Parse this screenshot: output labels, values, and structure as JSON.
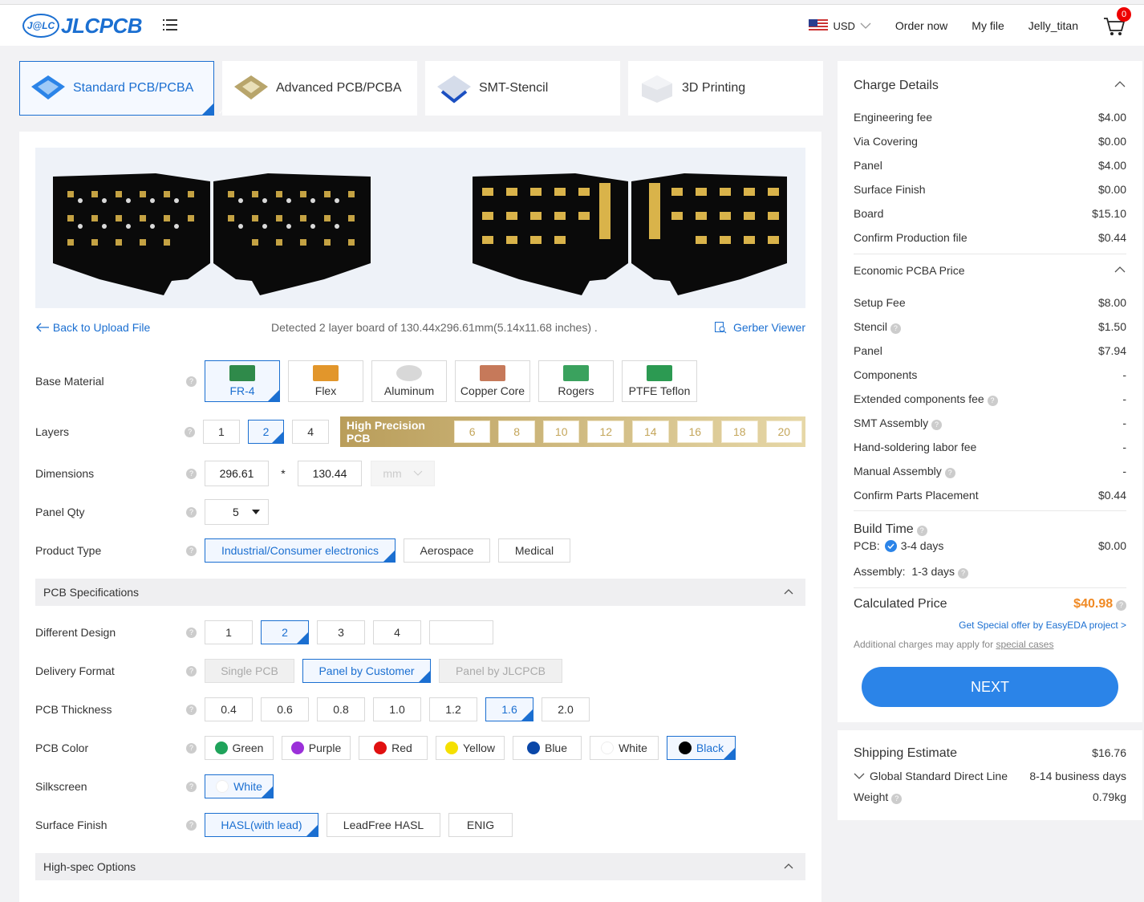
{
  "header": {
    "logo_badge": "J@LC",
    "logo_text": "JLCPCB",
    "currency": "USD",
    "order_now": "Order now",
    "my_file": "My file",
    "username": "Jelly_titan",
    "cart_count": "0"
  },
  "tabs": [
    {
      "label": "Standard PCB/PCBA",
      "active": true
    },
    {
      "label": "Advanced PCB/PCBA"
    },
    {
      "label": "SMT-Stencil"
    },
    {
      "label": "3D Printing"
    }
  ],
  "upload": {
    "back": "Back to Upload File",
    "detected": "Detected 2 layer board of 130.44x296.61mm(5.14x11.68 inches) .",
    "gerber": "Gerber Viewer"
  },
  "form": {
    "base_material": {
      "label": "Base Material",
      "options": [
        "FR-4",
        "Flex",
        "Aluminum",
        "Copper Core",
        "Rogers",
        "PTFE Teflon"
      ],
      "selected": "FR-4"
    },
    "layers": {
      "label": "Layers",
      "options": [
        "1",
        "2",
        "4"
      ],
      "selected": "2",
      "hp_label": "High Precision PCB",
      "hp_options": [
        "6",
        "8",
        "10",
        "12",
        "14",
        "16",
        "18",
        "20"
      ]
    },
    "dimensions": {
      "label": "Dimensions",
      "x": "296.61",
      "sep": "*",
      "y": "130.44",
      "unit": "mm"
    },
    "panel_qty": {
      "label": "Panel Qty",
      "value": "5"
    },
    "product_type": {
      "label": "Product Type",
      "options": [
        "Industrial/Consumer electronics",
        "Aerospace",
        "Medical"
      ],
      "selected": "Industrial/Consumer electronics"
    },
    "pcb_specs_title": "PCB Specifications",
    "different_design": {
      "label": "Different Design",
      "options": [
        "1",
        "2",
        "3",
        "4",
        ""
      ],
      "selected": "2"
    },
    "delivery_format": {
      "label": "Delivery Format",
      "options": [
        "Single PCB",
        "Panel by Customer",
        "Panel by JLCPCB"
      ],
      "selected": "Panel by Customer"
    },
    "thickness": {
      "label": "PCB Thickness",
      "options": [
        "0.4",
        "0.6",
        "0.8",
        "1.0",
        "1.2",
        "1.6",
        "2.0"
      ],
      "selected": "1.6"
    },
    "color": {
      "label": "PCB Color",
      "options": [
        {
          "name": "Green",
          "color": "#1fa35b"
        },
        {
          "name": "Purple",
          "color": "#9b30d9"
        },
        {
          "name": "Red",
          "color": "#e01010"
        },
        {
          "name": "Yellow",
          "color": "#f5e000"
        },
        {
          "name": "Blue",
          "color": "#0a47a8"
        },
        {
          "name": "White",
          "color": "#ffffff"
        },
        {
          "name": "Black",
          "color": "#000000"
        }
      ],
      "selected": "Black"
    },
    "silkscreen": {
      "label": "Silkscreen",
      "value": "White"
    },
    "surface_finish": {
      "label": "Surface Finish",
      "options": [
        "HASL(with lead)",
        "LeadFree HASL",
        "ENIG"
      ],
      "selected": "HASL(with lead)"
    },
    "highspec_title": "High-spec Options"
  },
  "charges": {
    "title": "Charge Details",
    "items": [
      {
        "label": "Engineering fee",
        "value": "$4.00"
      },
      {
        "label": "Via Covering",
        "value": "$0.00"
      },
      {
        "label": "Panel",
        "value": "$4.00"
      },
      {
        "label": "Surface Finish",
        "value": "$0.00"
      },
      {
        "label": "Board",
        "value": "$15.10"
      },
      {
        "label": "Confirm Production file",
        "value": "$0.44"
      }
    ],
    "pcba_title": "Economic PCBA Price",
    "pcba_items": [
      {
        "label": "Setup Fee",
        "value": "$8.00"
      },
      {
        "label": "Stencil",
        "value": "$1.50"
      },
      {
        "label": "Panel",
        "value": "$7.94"
      },
      {
        "label": "Components",
        "value": "-"
      },
      {
        "label": "Extended components fee",
        "value": "-"
      },
      {
        "label": "SMT Assembly",
        "value": "-"
      },
      {
        "label": "Hand-soldering labor fee",
        "value": "-"
      },
      {
        "label": "Manual Assembly",
        "value": "-"
      },
      {
        "label": "Confirm Parts Placement",
        "value": "$0.44"
      }
    ],
    "build_time_title": "Build Time",
    "pcb_label": "PCB:",
    "pcb_days": "3-4 days",
    "pcb_price": "$0.00",
    "assembly": "Assembly:  1-3 days",
    "calc_label": "Calculated Price",
    "calc_value": "$40.98",
    "special_offer": "Get Special offer by EasyEDA project >",
    "additional": "Additional charges may apply for",
    "special_cases": "special cases",
    "next": "NEXT"
  },
  "shipping": {
    "title": "Shipping Estimate",
    "price": "$16.76",
    "method": "Global Standard Direct Line",
    "days": "8-14 business days",
    "weight_label": "Weight",
    "weight": "0.79kg"
  }
}
